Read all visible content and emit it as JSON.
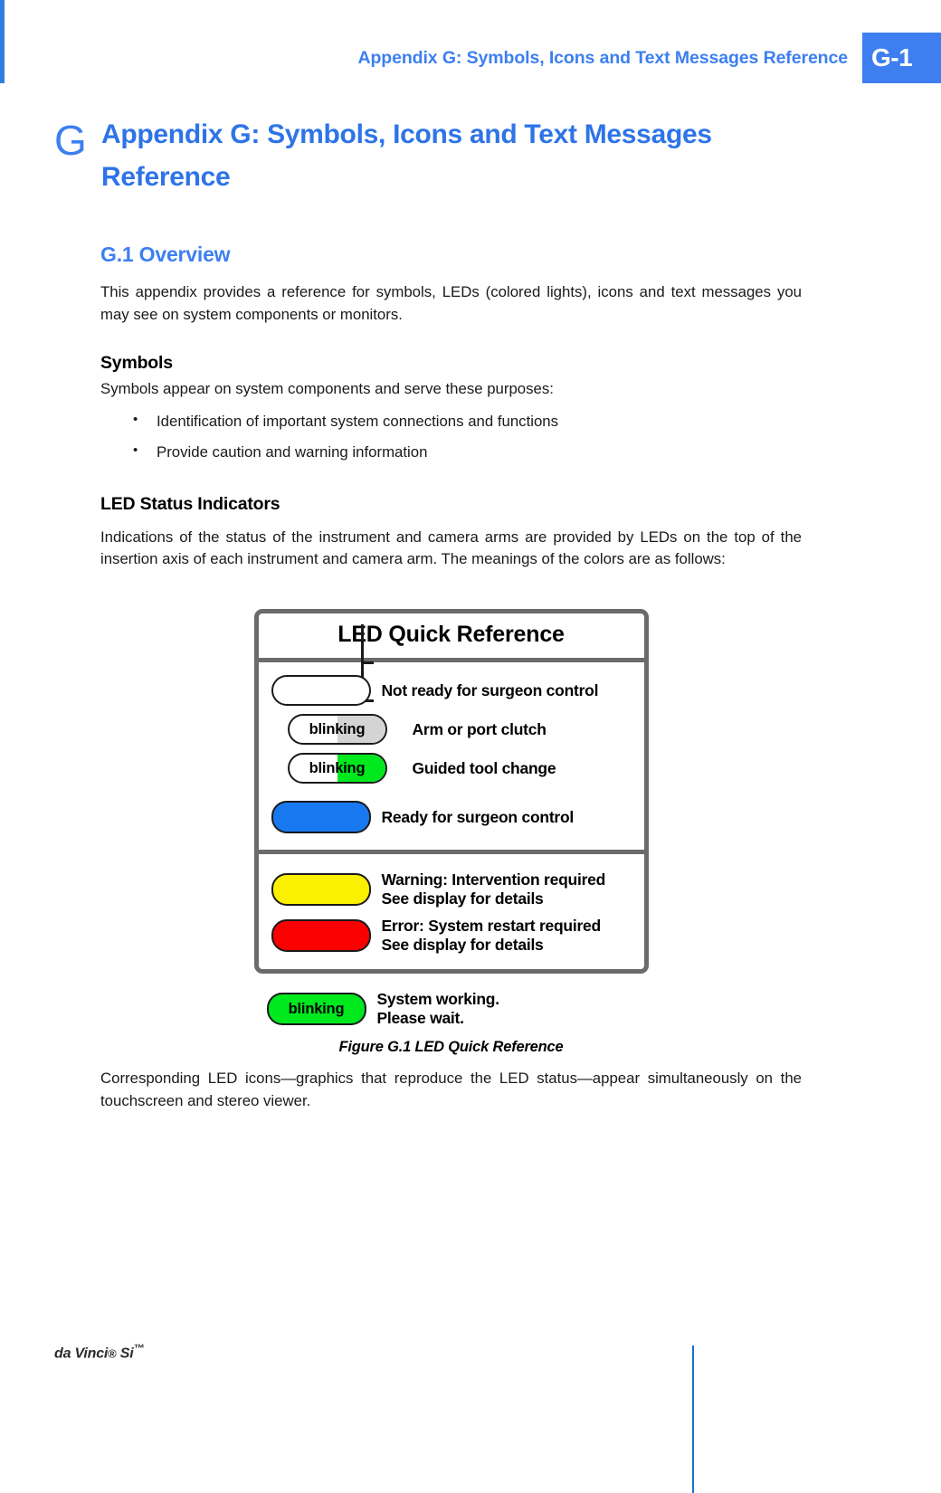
{
  "header": {
    "running_title": "Appendix G: Symbols, Icons and Text Messages Reference",
    "page_number": "G-1",
    "accent_color": "#3d7ff0"
  },
  "chapter": {
    "letter": "G",
    "title": "Appendix G: Symbols, Icons and Text Messages Reference"
  },
  "sections": {
    "overview_heading": "G.1 Overview",
    "overview_paragraph": "This appendix provides a reference for symbols, LEDs (colored lights), icons and text messages you may see on system components or monitors.",
    "symbols_heading": "Symbols",
    "symbols_intro": "Symbols appear on system components and serve these purposes:",
    "symbols_bullets": [
      "Identification of important system connections and functions",
      "Provide caution and warning information"
    ],
    "led_heading": "LED Status Indicators",
    "led_paragraph": "Indications of the status of the instrument and camera arms are provided by LEDs on the top of the insertion axis of each instrument and camera arm. The meanings of the colors are as follows:",
    "after_figure_paragraph": "Corresponding LED icons—graphics that reproduce the LED status—appear simultaneously on the touchscreen and stereo viewer."
  },
  "figure": {
    "title": "LED Quick Reference",
    "caption": "Figure G.1 LED Quick Reference",
    "border_color": "#6b6b6b",
    "rows_section_one": [
      {
        "lamp_label": "",
        "lamp_fill": "#ffffff",
        "lamp_half_fill": "",
        "description": "Not ready for surgeon control",
        "description_line2": ""
      },
      {
        "lamp_label": "blinking",
        "lamp_fill": "#ffffff",
        "lamp_half_fill": "#d4d4d4",
        "description": "Arm or port clutch",
        "description_line2": ""
      },
      {
        "lamp_label": "blinking",
        "lamp_fill": "#ffffff",
        "lamp_half_fill": "#00e81e",
        "description": "Guided tool change",
        "description_line2": ""
      },
      {
        "lamp_label": "",
        "lamp_fill": "#1878f0",
        "lamp_half_fill": "",
        "description": "Ready for surgeon control",
        "description_line2": ""
      }
    ],
    "rows_section_two": [
      {
        "lamp_label": "",
        "lamp_fill": "#fbf000",
        "lamp_half_fill": "",
        "description": "Warning: Intervention required",
        "description_line2": "See display for details"
      },
      {
        "lamp_label": "",
        "lamp_fill": "#fa0000",
        "lamp_half_fill": "",
        "description": "Error: System restart required",
        "description_line2": "See display for details"
      }
    ],
    "row_outside": {
      "lamp_label": "blinking",
      "lamp_fill": "#00e81e",
      "lamp_half_fill": "",
      "description": "System working.",
      "description_line2": "Please wait."
    }
  },
  "footer": {
    "product": "da Vinci",
    "registered": "®",
    "model": " Si",
    "trademark": "™",
    "rule_color": "#1a71c8"
  }
}
